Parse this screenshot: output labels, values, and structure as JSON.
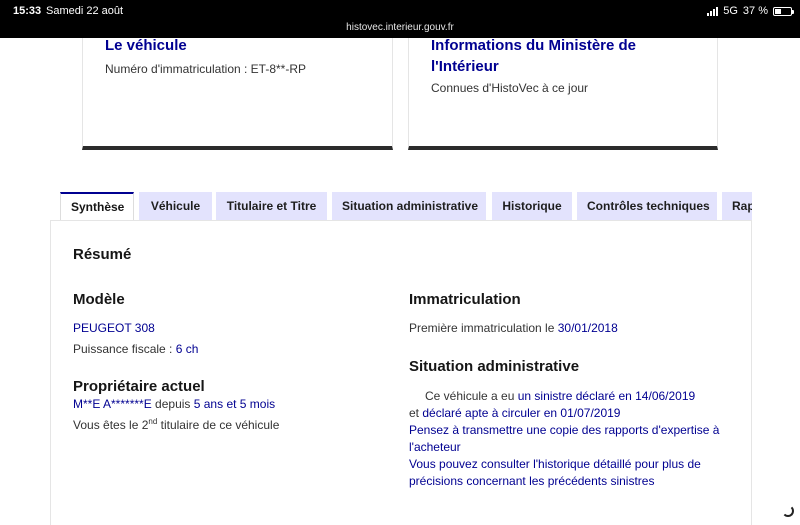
{
  "status_bar": {
    "time": "15:33",
    "date": "Samedi 22 août",
    "url": "histovec.interieur.gouv.fr",
    "network": "5G",
    "battery": "37 %",
    "battery_level": 0.37
  },
  "cards": {
    "vehicle": {
      "title": "Le véhicule",
      "text": "Numéro d'immatriculation : ET-8**-RP"
    },
    "ministry": {
      "title": "Informations du Ministère de l'Intérieur",
      "text": "Connues d'HistoVec à ce jour"
    }
  },
  "tabs": [
    {
      "label": "Synthèse",
      "active": true
    },
    {
      "label": "Véhicule",
      "active": false
    },
    {
      "label": "Titulaire et Titre",
      "active": false
    },
    {
      "label": "Situation administrative",
      "active": false
    },
    {
      "label": "Historique",
      "active": false
    },
    {
      "label": "Contrôles techniques",
      "active": false
    },
    {
      "label": "Rap",
      "active": false
    }
  ],
  "summary": {
    "title": "Résumé",
    "model": {
      "heading": "Modèle",
      "name": "PEUGEOT 308",
      "power_label": "Puissance fiscale : ",
      "power_value": "6 ch"
    },
    "owner": {
      "heading": "Propriétaire actuel",
      "name": "M**E A*******E",
      "since_label": " depuis ",
      "since_value": "5 ans et 5 mois",
      "rank_prefix": "Vous êtes le 2",
      "rank_sup": "nd",
      "rank_suffix": " titulaire de ce véhicule"
    },
    "registration": {
      "heading": "Immatriculation",
      "first_label": "Première immatriculation le ",
      "first_date": "30/01/2018"
    },
    "admin": {
      "heading": "Situation administrative",
      "line1_prefix": "Ce véhicule a eu ",
      "line1_link": "un sinistre déclaré en 14/06/2019",
      "line2_prefix": "et ",
      "line2_link": "déclaré apte à circuler en 01/07/2019",
      "line3": "Pensez à transmettre une copie des rapports d'expertise à",
      "line4": "l'acheteur",
      "line5": "Vous pouvez consulter l'historique détaillé pour plus de",
      "line6": "précisions concernant les précédents sinistres"
    }
  }
}
